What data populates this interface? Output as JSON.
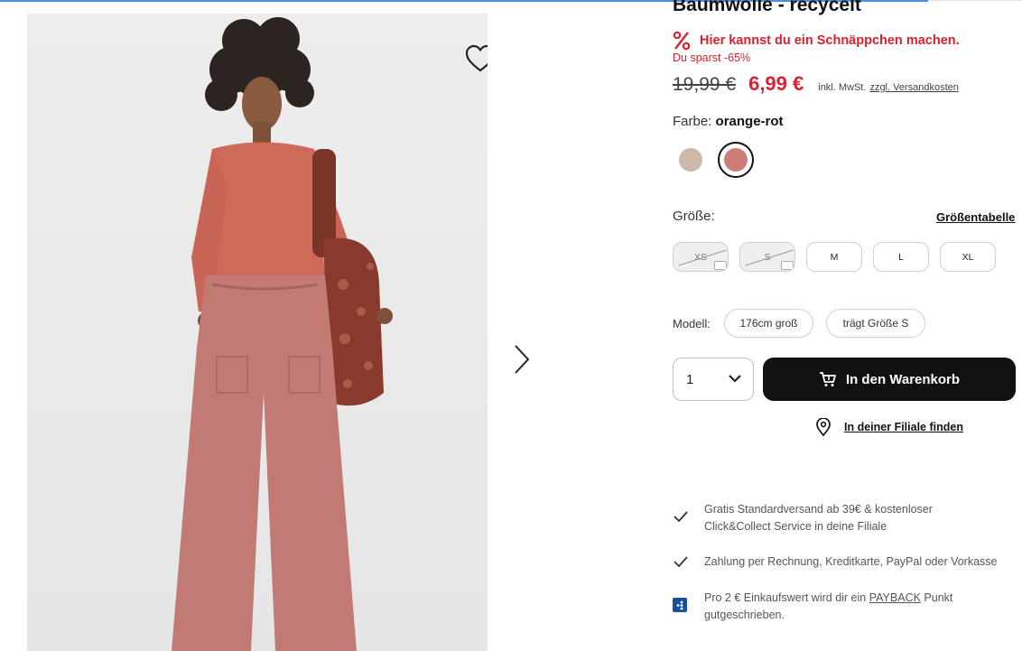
{
  "product": {
    "title": "Baumwolle - recycelt",
    "deal_text": "Hier kannst du ein Schnäppchen machen.",
    "savings_text": "Du sparst -65%",
    "old_price": "19,99 €",
    "new_price": "6,99 €",
    "tax_note": "inkl. MwSt.",
    "shipping_link": "zzgl. Versandkosten"
  },
  "color": {
    "label": "Farbe:",
    "selected": "orange-rot",
    "swatches": [
      {
        "name": "beige",
        "hex": "#cbb8a8"
      },
      {
        "name": "orange-rot",
        "hex": "#cf7d78"
      }
    ]
  },
  "sizes": {
    "label": "Größe:",
    "chart_link": "Größentabelle",
    "options": [
      {
        "label": "XS",
        "available": false
      },
      {
        "label": "S",
        "available": false
      },
      {
        "label": "M",
        "available": true
      },
      {
        "label": "L",
        "available": true
      },
      {
        "label": "XL",
        "available": true
      }
    ]
  },
  "model": {
    "label": "Modell:",
    "height": "176cm groß",
    "size": "trägt Größe S"
  },
  "purchase": {
    "quantity": "1",
    "cart_button": "In den Warenkorb",
    "store_link": "In deiner Filiale finden"
  },
  "benefits": {
    "shipping_line1": "Gratis Standardversand ab 39€ & kostenloser",
    "shipping_line2": "Click&Collect Service in deine Filiale",
    "payment": "Zahlung per Rechnung, Kreditkarte, PayPal oder Vorkasse",
    "payback_pre": "Pro 2 € Einkaufswert wird dir ein",
    "payback_link": "PAYBACK",
    "payback_post": "Punkt",
    "payback_line2": "gutgeschrieben."
  },
  "colors": {
    "accent_red": "#d9212f",
    "button_black": "#111111",
    "payback_blue": "#1a4fa0"
  }
}
